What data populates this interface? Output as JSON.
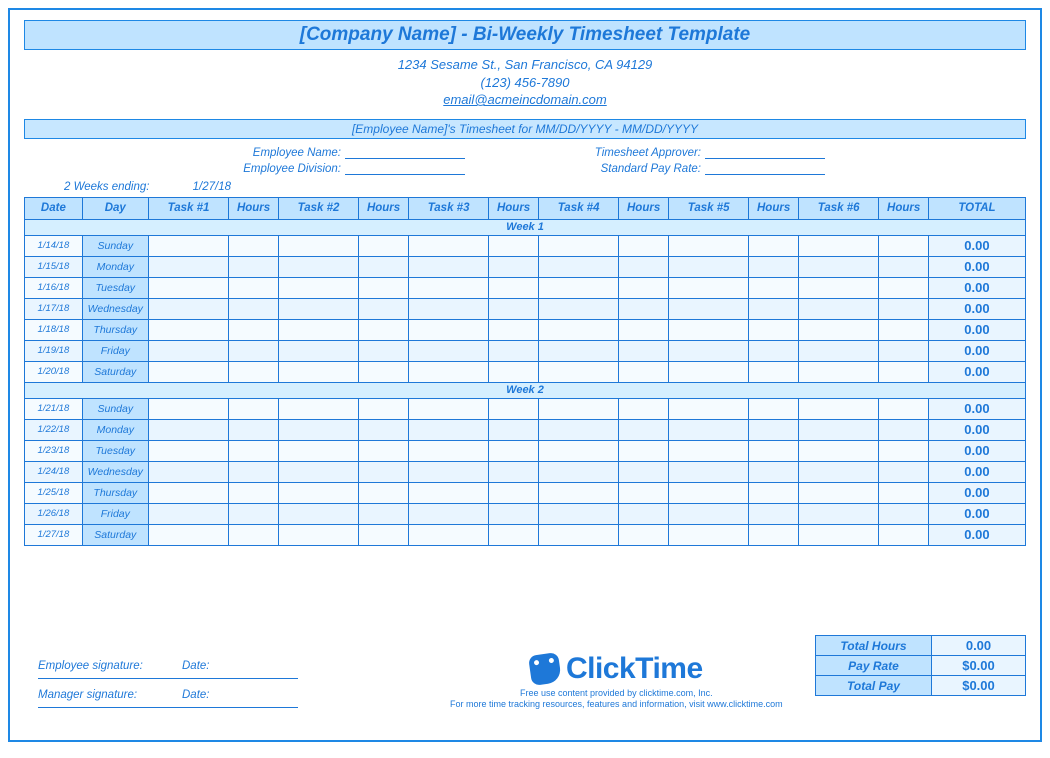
{
  "header": {
    "title": "[Company Name] - Bi-Weekly Timesheet Template",
    "address": "1234 Sesame St.,  San Francisco, CA 94129",
    "phone": "(123) 456-7890",
    "email": "email@acmeincdomain.com",
    "subhead": "[Employee Name]'s Timesheet for MM/DD/YYYY - MM/DD/YYYY"
  },
  "emp": {
    "name_label": "Employee Name:",
    "division_label": "Employee Division:",
    "approver_label": "Timesheet Approver:",
    "payrate_label": "Standard Pay Rate:"
  },
  "period": {
    "label": "2 Weeks ending:",
    "value": "1/27/18"
  },
  "cols": [
    "Date",
    "Day",
    "Task #1",
    "Hours",
    "Task #2",
    "Hours",
    "Task #3",
    "Hours",
    "Task #4",
    "Hours",
    "Task #5",
    "Hours",
    "Task #6",
    "Hours",
    "TOTAL"
  ],
  "week_labels": [
    "Week 1",
    "Week 2"
  ],
  "weeks": [
    [
      {
        "date": "1/14/18",
        "day": "Sunday",
        "total": "0.00"
      },
      {
        "date": "1/15/18",
        "day": "Monday",
        "total": "0.00"
      },
      {
        "date": "1/16/18",
        "day": "Tuesday",
        "total": "0.00"
      },
      {
        "date": "1/17/18",
        "day": "Wednesday",
        "total": "0.00"
      },
      {
        "date": "1/18/18",
        "day": "Thursday",
        "total": "0.00"
      },
      {
        "date": "1/19/18",
        "day": "Friday",
        "total": "0.00"
      },
      {
        "date": "1/20/18",
        "day": "Saturday",
        "total": "0.00"
      }
    ],
    [
      {
        "date": "1/21/18",
        "day": "Sunday",
        "total": "0.00"
      },
      {
        "date": "1/22/18",
        "day": "Monday",
        "total": "0.00"
      },
      {
        "date": "1/23/18",
        "day": "Tuesday",
        "total": "0.00"
      },
      {
        "date": "1/24/18",
        "day": "Wednesday",
        "total": "0.00"
      },
      {
        "date": "1/25/18",
        "day": "Thursday",
        "total": "0.00"
      },
      {
        "date": "1/26/18",
        "day": "Friday",
        "total": "0.00"
      },
      {
        "date": "1/27/18",
        "day": "Saturday",
        "total": "0.00"
      }
    ]
  ],
  "summary": {
    "total_hours_label": "Total Hours",
    "total_hours": "0.00",
    "payrate_label": "Pay Rate",
    "payrate": "$0.00",
    "totalpay_label": "Total Pay",
    "totalpay": "$0.00"
  },
  "sig": {
    "emp_label": "Employee signature:",
    "mgr_label": "Manager signature:",
    "date_label": "Date:"
  },
  "brand": {
    "name": "ClickTime",
    "foot1": "Free use content provided by clicktime.com, Inc.",
    "foot2": "For more time tracking resources, features and information, visit www.clicktime.com"
  }
}
